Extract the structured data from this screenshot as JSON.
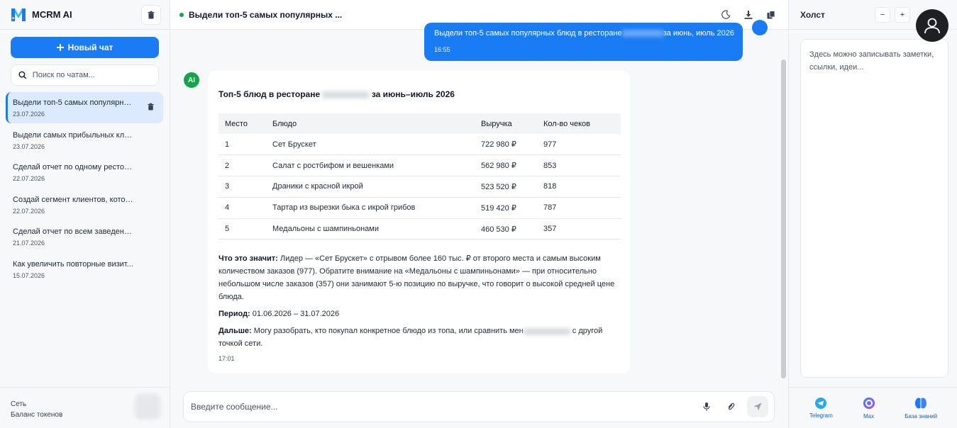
{
  "sidebar": {
    "brand": "MCRM AI",
    "new_chat_label": "Новый чат",
    "search_placeholder": "Поиск по чатам...",
    "chats": [
      {
        "title": "Выдели топ-5 самых популярны...",
        "date": "23.07.2026"
      },
      {
        "title": "Выдели самых прибыльных кли...",
        "date": "23.07.2026"
      },
      {
        "title": "Сделай отчет по одному рестора...",
        "date": "22.07.2026"
      },
      {
        "title": "Создай сегмент клиентов, котор...",
        "date": "22.07.2026"
      },
      {
        "title": "Сделай отчет по всем заведения...",
        "date": "21.07.2026"
      },
      {
        "title": "Как увеличить повторные визит...",
        "date": "15.07.2026"
      }
    ],
    "footer": {
      "network_label": "Сеть",
      "tokens_label": "Баланс токенов"
    }
  },
  "header": {
    "title": "Выдели топ-5 самых популярных ..."
  },
  "messages": {
    "user": {
      "text_before": "Выдели топ-5 самых популярных блюд в ресторане",
      "text_after": "за июнь, июль 2026",
      "time": "16:55"
    },
    "ai": {
      "heading_before": "Топ-5 блюд в ресторане",
      "heading_after": "за июнь–июль 2026",
      "table": {
        "headers": [
          "Место",
          "Блюдо",
          "Выручка",
          "Кол-во чеков"
        ],
        "rows": [
          [
            "1",
            "Сет Брускет",
            "722 980 ₽",
            "977"
          ],
          [
            "2",
            "Салат с ростбифом и вешенками",
            "562 980 ₽",
            "853"
          ],
          [
            "3",
            "Драники с красной икрой",
            "523 520 ₽",
            "818"
          ],
          [
            "4",
            "Тартар из вырезки быка с икрой грибов",
            "519 420 ₽",
            "787"
          ],
          [
            "5",
            "Медальоны с шампиньонами",
            "460 530 ₽",
            "357"
          ]
        ]
      },
      "meaning_label": "Что это значит:",
      "meaning_text": " Лидер — «Сет Брускет» с отрывом более 160 тыс. ₽ от второго места и самым высоким количеством заказов (977). Обратите внимание на «Медальоны с шампиньонами» — при относительно небольшом числе заказов (357) они занимают 5-ю позицию по выручке, что говорит о высокой средней цене блюда.",
      "period_label": "Период:",
      "period_text": " 01.06.2026 – 31.07.2026",
      "next_label": "Дальше:",
      "next_text_before": " Могу разобрать, кто покупал конкретное блюдо из топа, или сравнить мен",
      "next_text_after": " с другой точкой сети.",
      "time": "17:01"
    }
  },
  "composer": {
    "placeholder": "Введите сообщение..."
  },
  "canvas": {
    "title": "Холст",
    "zoom_out": "−",
    "zoom_in": "+",
    "notes_placeholder": "Здесь можно записывать заметки, ссылки, идеи...",
    "links": [
      {
        "label": "Telegram",
        "icon": "telegram-icon"
      },
      {
        "label": "Max",
        "icon": "max-icon"
      },
      {
        "label": "База знаний",
        "icon": "brain-icon"
      }
    ]
  },
  "colors": {
    "accent": "#1a7cf5",
    "status": "#16a34a"
  }
}
